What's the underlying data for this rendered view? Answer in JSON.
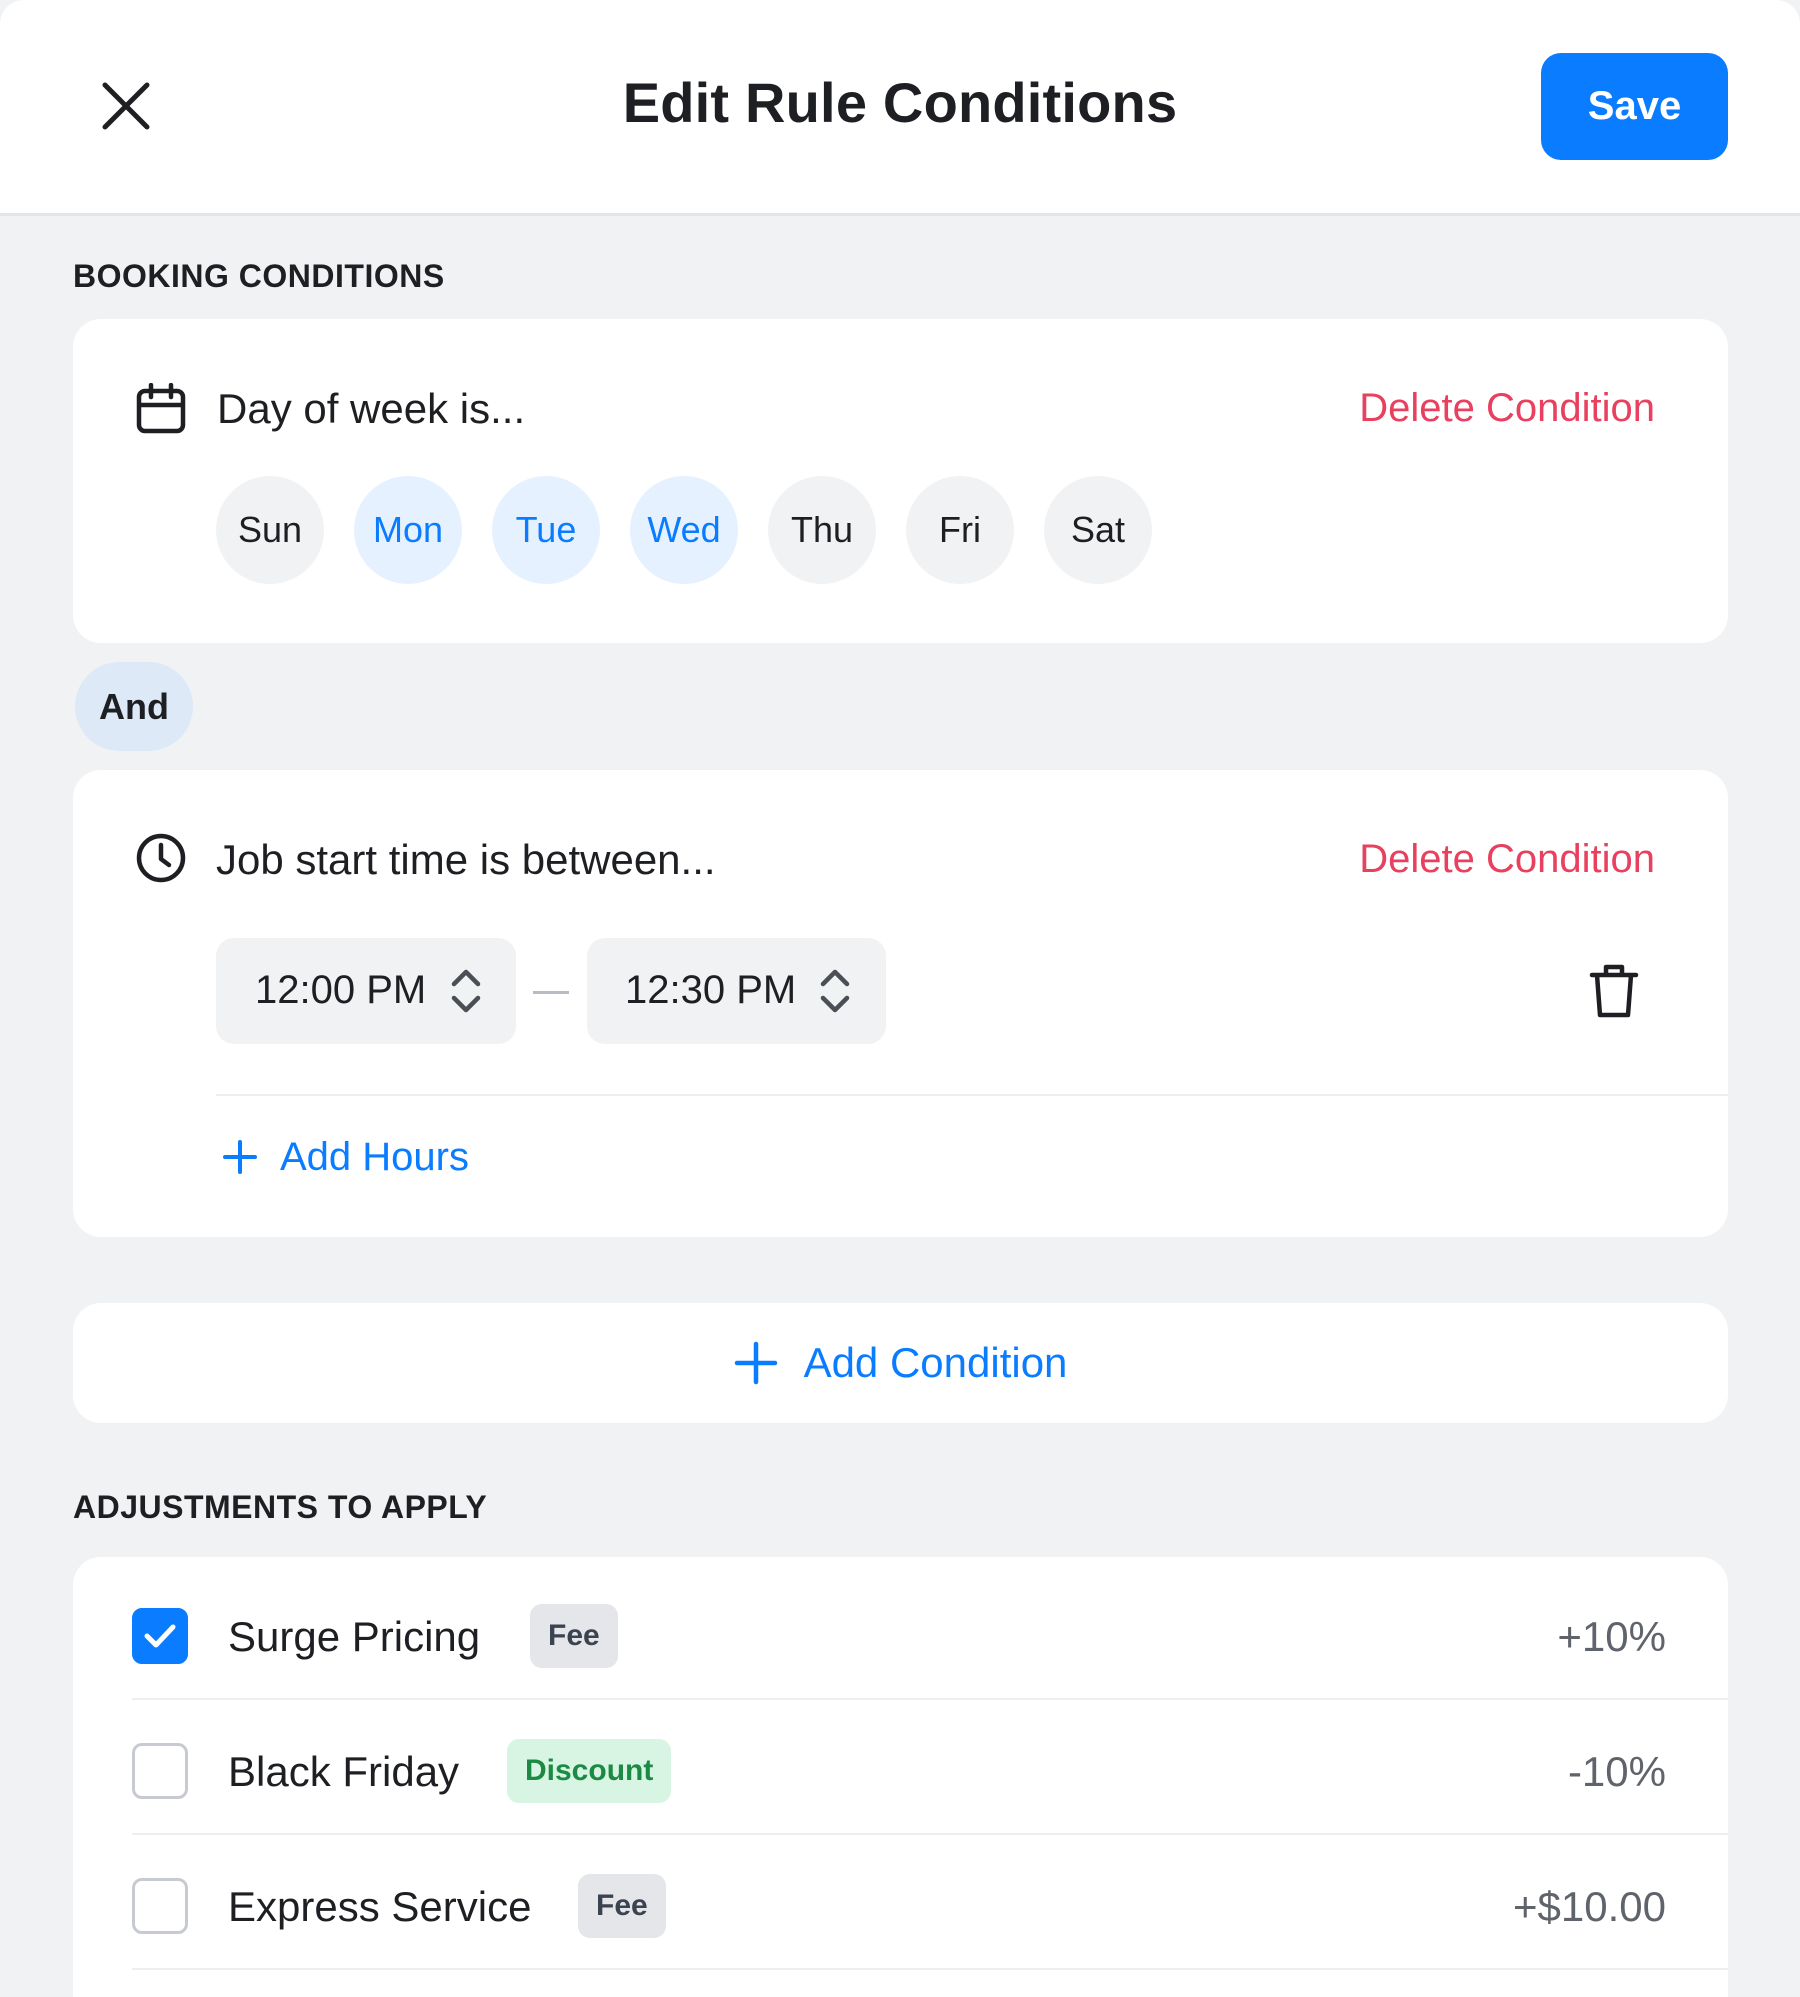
{
  "header": {
    "title": "Edit Rule Conditions",
    "save_label": "Save"
  },
  "booking": {
    "section_label": "BOOKING CONDITIONS",
    "day_condition": {
      "title": "Day of week is...",
      "delete_label": "Delete Condition",
      "days": [
        {
          "label": "Sun",
          "selected": false
        },
        {
          "label": "Mon",
          "selected": true
        },
        {
          "label": "Tue",
          "selected": true
        },
        {
          "label": "Wed",
          "selected": true
        },
        {
          "label": "Thu",
          "selected": false
        },
        {
          "label": "Fri",
          "selected": false
        },
        {
          "label": "Sat",
          "selected": false
        }
      ]
    },
    "connector": "And",
    "time_condition": {
      "title": "Job start time is between...",
      "delete_label": "Delete Condition",
      "start_time": "12:00 PM",
      "end_time": "12:30 PM",
      "add_hours_label": "Add Hours"
    },
    "add_condition_label": "Add Condition"
  },
  "adjustments": {
    "section_label": "ADJUSTMENTS TO APPLY",
    "items": [
      {
        "name": "Surge Pricing",
        "tag": "Fee",
        "value": "+10%",
        "checked": true
      },
      {
        "name": "Black Friday",
        "tag": "Discount",
        "value": "-10%",
        "checked": false
      },
      {
        "name": "Express Service",
        "tag": "Fee",
        "value": "+$10.00",
        "checked": false
      }
    ]
  },
  "colors": {
    "accent": "#0a7cff",
    "danger": "#e8405e",
    "discount_tag_bg": "#d8f5e3",
    "discount_tag_text": "#1c8a44",
    "fee_tag_bg": "#e4e6ea"
  },
  "icons": [
    "close-icon",
    "calendar-icon",
    "clock-icon",
    "chevron-updown-icon",
    "trash-icon",
    "plus-icon",
    "checkmark-icon"
  ]
}
